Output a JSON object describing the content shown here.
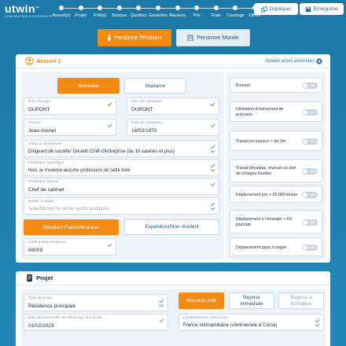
{
  "brand": {
    "name": "utwin",
    "tm": "™",
    "tagline": "COMPARATEUR D'ASSURANCE"
  },
  "steps": [
    {
      "label": "Assuré(s)"
    },
    {
      "label": "Projet"
    },
    {
      "label": "Prêt(s)"
    },
    {
      "label": "Banque"
    },
    {
      "label": "Quotités"
    },
    {
      "label": "Garanties"
    },
    {
      "label": "Recours"
    },
    {
      "label": "Prix"
    },
    {
      "label": "Frais"
    },
    {
      "label": "Courtage"
    },
    {
      "label": "Offres"
    }
  ],
  "actions": {
    "duplicate": "Dupliquer",
    "save": "Enregistrer"
  },
  "person_type": {
    "physical": "Personne Physique",
    "moral": "Personne Morale"
  },
  "insured": {
    "title": "Assuré 1",
    "add_link": "Ajouter un(e) assuré(e)",
    "gender": {
      "male": "Monsieur",
      "female": "Madame"
    },
    "fields": {
      "usage_name": {
        "label": "Nom d'usage",
        "value": "DUPONT"
      },
      "birth_name": {
        "label": "Nom de naissance",
        "value": "DUPONT"
      },
      "first_name": {
        "label": "Prénom",
        "value": "Jean-michel"
      },
      "birth_date": {
        "label": "Date de naissance",
        "value": "18/03/1970"
      },
      "status": {
        "label": "Statut professionnel",
        "value": "Dirigeant de société/ Gérant/ Chef d'entreprise (de 10 salariés et plus)"
      },
      "profession": {
        "label": "Profession spécifique",
        "value": "Non, je n'exerce aucune profession de cette liste"
      },
      "exact_profession": {
        "label": "Profession exacte",
        "value": "Chef de cabinet"
      },
      "sports": {
        "label": "Sports à risque",
        "placeholder": "Sélectionnez le ou les sports pratiqués"
      },
      "postal_code": {
        "label": "Code postal résidence",
        "value": "69009"
      }
    },
    "residence": {
      "france": "Résident France/Monaco",
      "abroad": "Expatrié(e)/Non résident"
    },
    "options": [
      {
        "label": "Fumeur",
        "state": "NON"
      },
      {
        "label": "Utilisation d'instrument de précision",
        "state": "NON"
      },
      {
        "label": "Travail en hauteur + de 3m",
        "state": "NON"
      },
      {
        "label": "Travail physique, manuel ou port de charges lourdes",
        "state": "NON"
      },
      {
        "label": "Déplacement pro + 20.000 km/an",
        "state": "NON"
      },
      {
        "label": "Déplacement à l'étranger + 60 jours/an",
        "state": "NON"
      },
      {
        "label": "Déplacement pays à risque",
        "state": "NON"
      }
    ]
  },
  "project": {
    "title": "Projet",
    "fields": {
      "type": {
        "label": "Type de projet",
        "value": "Résidence principale"
      },
      "date": {
        "label": "Date prévisionnelle de déblocage des fonds",
        "value": "01/02/2023"
      },
      "location": {
        "label": "Localisation de votre projet",
        "value": "France métropolitaine (continentale & Corse)"
      }
    },
    "loan_types": {
      "new": "Nouveau prêt",
      "immediate": "Reprise immédiate",
      "deferred": "Reprise à échéance"
    }
  },
  "colors": {
    "accent": "#f28a14",
    "background": "#1f7fae",
    "check": "#6aa84f"
  }
}
